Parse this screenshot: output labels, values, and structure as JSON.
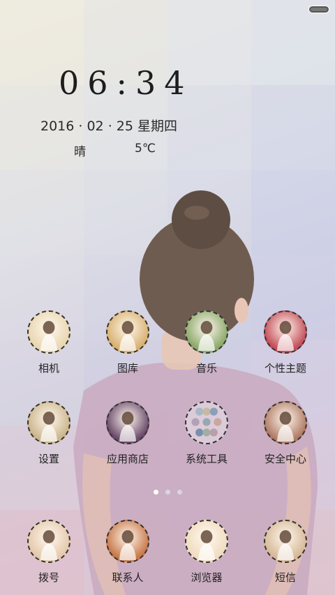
{
  "status": {
    "battery_icon": "battery-icon"
  },
  "lock": {
    "time": "06:34",
    "date": "2016 · 02 · 25 星期四",
    "weather": "晴",
    "temperature": "5℃"
  },
  "apps_page": [
    {
      "label": "相机",
      "icon": "camera-icon",
      "color": "#e8d6b0"
    },
    {
      "label": "图库",
      "icon": "gallery-icon",
      "color": "#d8b070"
    },
    {
      "label": "音乐",
      "icon": "music-icon",
      "color": "#8ca86a"
    },
    {
      "label": "个性主题",
      "icon": "theme-icon",
      "color": "#c44d5a"
    },
    {
      "label": "设置",
      "icon": "settings-icon",
      "color": "#cbb58c"
    },
    {
      "label": "应用商店",
      "icon": "app-store-icon",
      "color": "#6a4a6a"
    },
    {
      "label": "系统工具",
      "icon": "system-tools-folder-icon",
      "color": "#cfd8e0"
    },
    {
      "label": "安全中心",
      "icon": "security-center-icon",
      "color": "#b07a64"
    }
  ],
  "dock": [
    {
      "label": "拨号",
      "icon": "dialer-icon",
      "color": "#e4c8ac"
    },
    {
      "label": "联系人",
      "icon": "contacts-icon",
      "color": "#c8784a"
    },
    {
      "label": "浏览器",
      "icon": "browser-icon",
      "color": "#f0dcc0"
    },
    {
      "label": "短信",
      "icon": "messages-icon",
      "color": "#d6b898"
    }
  ],
  "page_indicator": {
    "count": 3,
    "active": 0
  }
}
